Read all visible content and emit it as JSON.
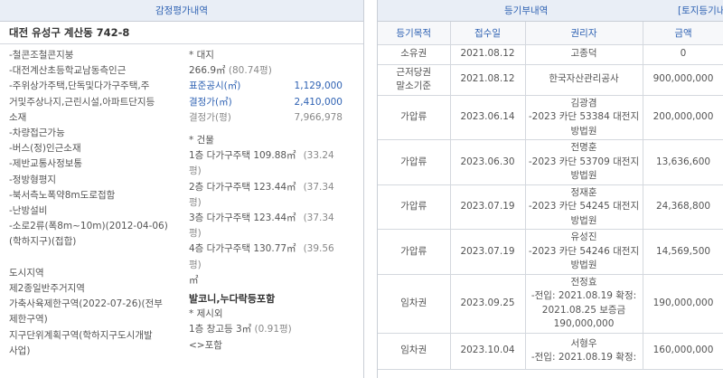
{
  "appraisal": {
    "title": "감정평가내역",
    "address": "대전 유성구 계산동 742-8",
    "features": [
      "-철콘조철콘지붕",
      "-대전계산초등학교남동측인근",
      "-주위상가주택,단독및다가구주택,주",
      "거및주상나지,근린시설,아파트단지등",
      "소재",
      "-차량접근가능",
      "-버스(정)인근소재",
      "-제반교통사정보통",
      "-정방형평지",
      "-북서측노폭약8m도로접함",
      "-난방설비",
      "-소로2류(폭8m~10m)(2012-04-06)",
      "(학하지구)(접합)",
      "",
      "도시지역",
      "제2종일반주거지역",
      "가축사육제한구역(2022-07-26)(전부",
      "제한구역)",
      "지구단위계획구역(학하지구도시개발",
      "사업)"
    ],
    "land": {
      "label": "* 대지",
      "area": "266.9㎡",
      "area_pyeong": "(80.74평)",
      "public_price_label": "표준공시(㎡)",
      "public_price": "1,129,000",
      "decided_price_label": "결정가(㎡)",
      "decided_price": "2,410,000",
      "decided_pyeong_label": "결정가(평)",
      "decided_pyeong": "7,966,978"
    },
    "building": {
      "label": "* 건물",
      "floors": [
        {
          "desc": "1층 다가구주택 109.88㎡",
          "pyeong": "(33.24",
          "unit": "평)"
        },
        {
          "desc": "2층 다가구주택 123.44㎡",
          "pyeong": "(37.34",
          "unit": "평)"
        },
        {
          "desc": "3층 다가구주택 123.44㎡",
          "pyeong": "(37.34",
          "unit": "평)"
        },
        {
          "desc": "4층 다가구주택 130.77㎡",
          "pyeong": "(39.56",
          "unit": "평)"
        }
      ],
      "extra_unit": "㎡",
      "note": "발코니,누다락등포함",
      "exclusion_label": "* 제시외",
      "exclusion_item": "1층 창고등 3㎡",
      "exclusion_pyeong": "(0.91평)",
      "exclusion_incl": "<>포함"
    }
  },
  "registry": {
    "title": "등기부내역",
    "link": "[토지등기내역",
    "columns": [
      "등기목적",
      "접수일",
      "권리자",
      "금액"
    ],
    "rows": [
      {
        "purpose": "소유권",
        "purpose_note": "",
        "date": "2021.08.12",
        "holder": [
          "고종덕"
        ],
        "amount": "0"
      },
      {
        "purpose": "근저당권",
        "purpose_note": "말소기준",
        "date": "2021.08.12",
        "holder": [
          "한국자산관리공사"
        ],
        "amount": "900,000,000"
      },
      {
        "purpose": "가압류",
        "purpose_note": "",
        "date": "2023.06.14",
        "holder": [
          "김광겸",
          "-2023 카단 53384 대전지",
          "방법원"
        ],
        "amount": "200,000,000"
      },
      {
        "purpose": "가압류",
        "purpose_note": "",
        "date": "2023.06.30",
        "holder": [
          "전명훈",
          "-2023 카단 53709 대전지",
          "방법원"
        ],
        "amount": "13,636,600"
      },
      {
        "purpose": "가압류",
        "purpose_note": "",
        "date": "2023.07.19",
        "holder": [
          "정재훈",
          "-2023 카단 54245 대전지",
          "방법원"
        ],
        "amount": "24,368,800"
      },
      {
        "purpose": "가압류",
        "purpose_note": "",
        "date": "2023.07.19",
        "holder": [
          "유성진",
          "-2023 카단 54246 대전지",
          "방법원"
        ],
        "amount": "14,569,500"
      },
      {
        "purpose": "임차권",
        "purpose_note": "",
        "date": "2023.09.25",
        "holder": [
          "전정효",
          "-전입: 2021.08.19 확정:",
          "2021.08.25 보증금",
          "190,000,000"
        ],
        "amount": "190,000,000"
      },
      {
        "purpose": "임차권",
        "purpose_note": "",
        "date": "2023.10.04",
        "holder": [
          "서형우",
          "-전입: 2021.08.19 확정:"
        ],
        "amount": "160,000,000"
      }
    ]
  }
}
